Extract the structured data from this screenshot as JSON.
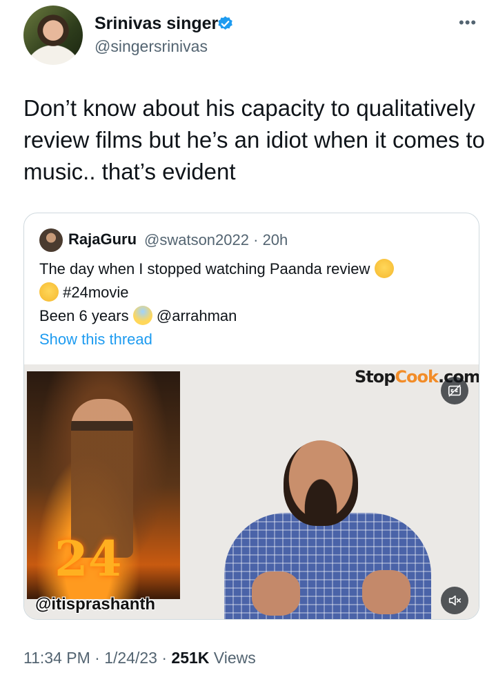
{
  "tweet": {
    "author_name": "Srinivas singer",
    "author_handle": "@singersrinivas",
    "text": "Don’t know about his capacity to qualitatively review films but he’s an idiot when it comes to music.. that’s evident",
    "time": "11:34 PM",
    "date": "1/24/23",
    "views_count": "251K",
    "views_label": "Views",
    "separator": "·"
  },
  "quote": {
    "author_name": "RajaGuru",
    "author_handle": "@swatson2022",
    "age": "20h",
    "line1": "The day when I stopped watching Paanda review",
    "line2_tag": "#24movie",
    "line3_prefix": "Been 6 years",
    "line3_mention": "@arrahman",
    "show_thread": "Show this thread",
    "media": {
      "brand_part1": "Stop",
      "brand_part2": "Cook",
      "brand_part3": ".com",
      "watermark": "@itisprashanth",
      "poster_title": "24"
    }
  },
  "icons": {
    "verified": "verified-badge-icon",
    "more": "more-options-icon",
    "captions": "closed-captions-icon",
    "mute": "speaker-muted-icon"
  },
  "colors": {
    "link": "#1d9bf0",
    "secondary_text": "#536471",
    "border": "#cfd9de"
  }
}
